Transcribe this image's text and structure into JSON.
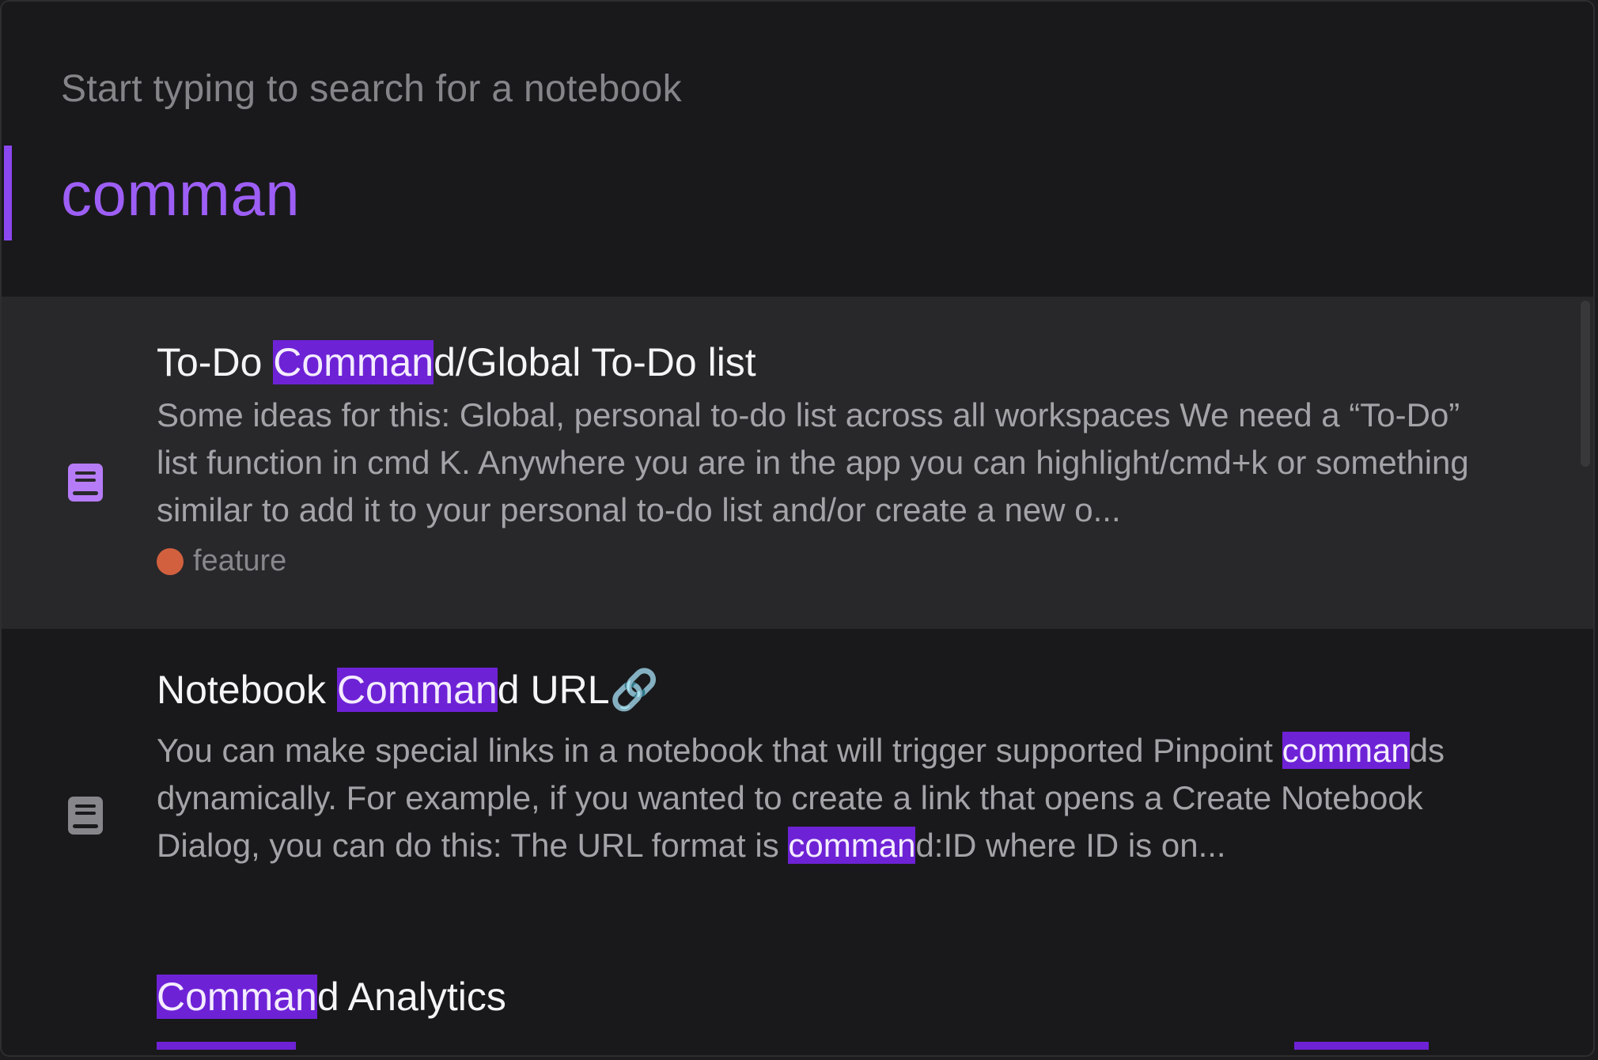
{
  "search": {
    "placeholder": "Start typing to search for a notebook",
    "query": "comman"
  },
  "colors": {
    "accent": "#8b47f0",
    "highlight": "#6e22d6",
    "selected_row": "#28282b",
    "feature_tag": "#d2603e"
  },
  "results": [
    {
      "icon": "notebook-icon",
      "selected": true,
      "title": {
        "pre": "To-Do ",
        "match": "Comman",
        "post": "d/Global To-Do list"
      },
      "snippet": "Some ideas for this: Global, personal to-do list across all workspaces We need a “To-Do” list function in cmd K. Anywhere you are in the app you can highlight/cmd+k or something similar to add it to your personal to-do list and/or create a new o...",
      "tag": {
        "label": "feature",
        "color": "#d2603e"
      }
    },
    {
      "icon": "notebook-icon",
      "selected": false,
      "title": {
        "pre": "Notebook ",
        "match": "Comman",
        "post": "d URL🔗"
      },
      "snippet_parts": {
        "p1": "You can make special links in a notebook that will trigger supported Pinpoint ",
        "m1": "comman",
        "p2": "ds dynamically. For example, if you wanted to create a link that opens a Create Notebook Dialog, you can do this: The URL format is ",
        "m2": "comman",
        "p3": "d:ID where ID is on..."
      }
    },
    {
      "icon": "notebook-icon",
      "selected": false,
      "title": {
        "pre": "",
        "match": "Comman",
        "post": "d Analytics"
      }
    }
  ]
}
